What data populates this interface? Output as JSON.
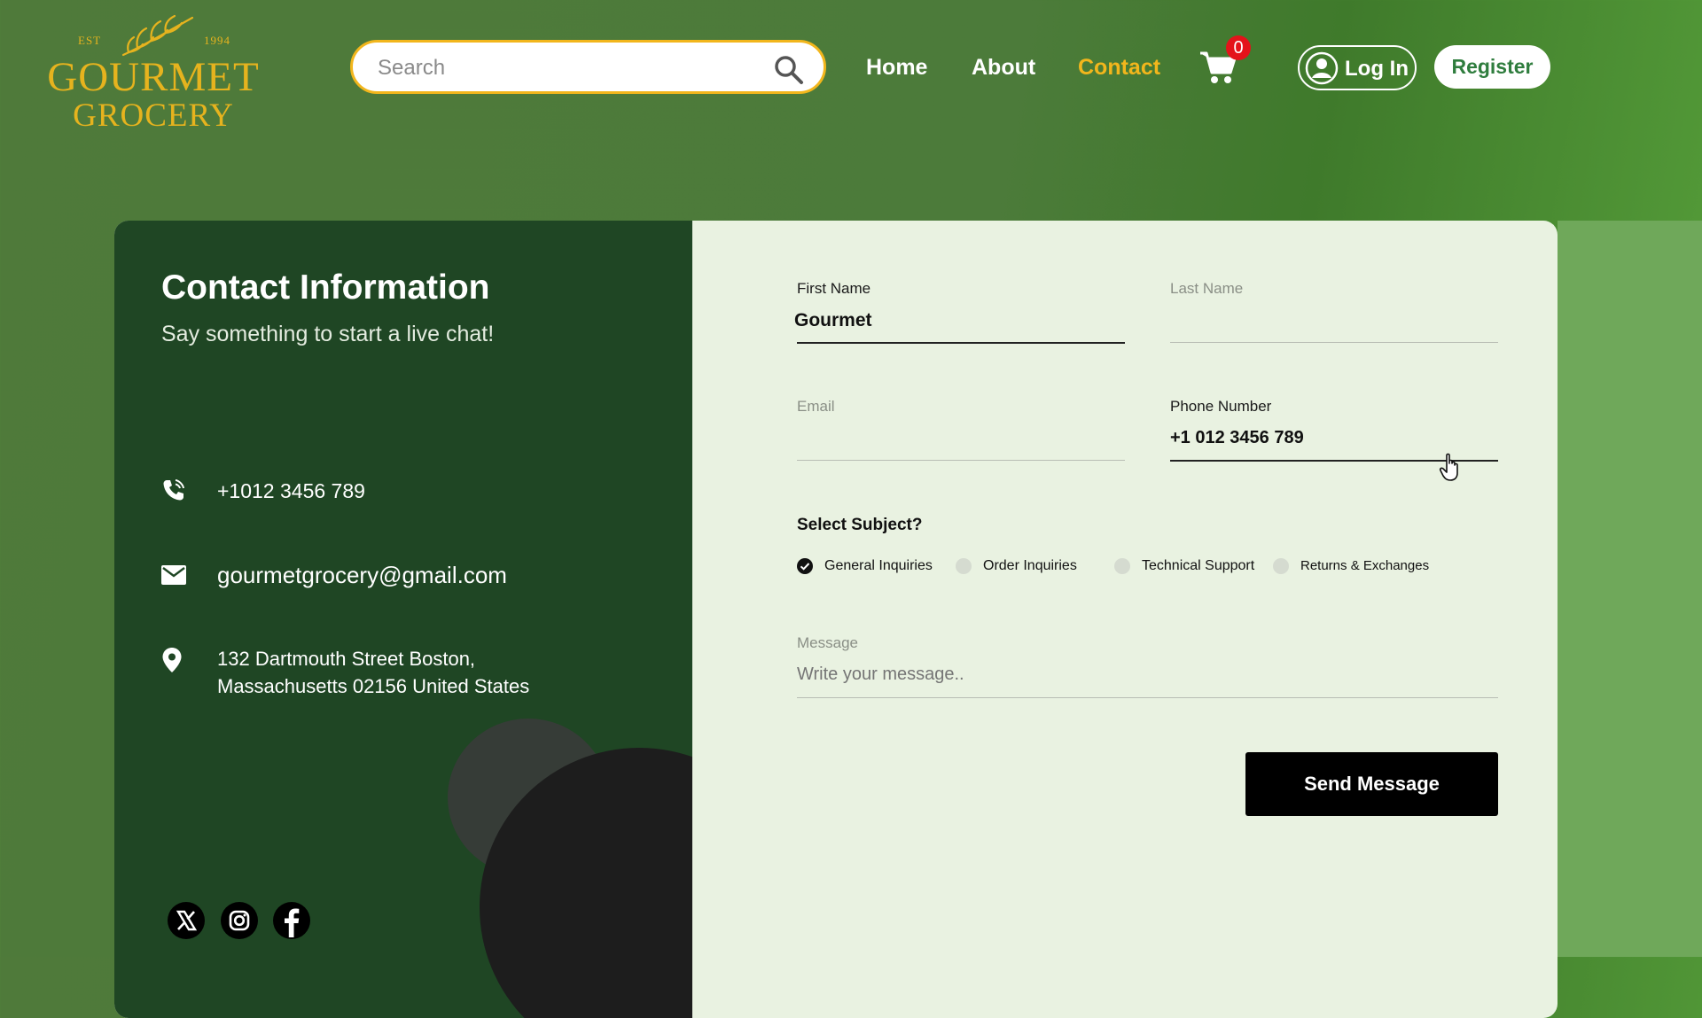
{
  "brand": {
    "est": "EST",
    "year": "1994",
    "line1": "GOURMET",
    "line2": "GROCERY",
    "color": "#e6b31e"
  },
  "search": {
    "placeholder": "Search",
    "value": "",
    "icon": "search-icon"
  },
  "nav": {
    "items": [
      {
        "label": "Home",
        "active": false
      },
      {
        "label": "About",
        "active": false
      },
      {
        "label": "Contact",
        "active": true
      }
    ],
    "active_color": "#f2b61c"
  },
  "cart": {
    "icon": "cart-icon",
    "count": "0",
    "badge_color": "#e4131a"
  },
  "auth": {
    "login_label": "Log In",
    "login_icon": "user-circle-icon",
    "register_label": "Register"
  },
  "contact_info": {
    "title": "Contact Information",
    "subtitle": "Say something to start a live chat!",
    "phone": "+1012 3456 789",
    "email": "gourmetgrocery@gmail.com",
    "address_line1": "132 Dartmouth Street Boston,",
    "address_line2": "Massachusetts 02156 United States",
    "socials": [
      "x-icon",
      "instagram-icon",
      "facebook-icon"
    ],
    "panel_color": "#1f4624"
  },
  "form": {
    "first_name": {
      "label": "First Name",
      "value": "Gourmet"
    },
    "last_name": {
      "label": "Last Name",
      "value": ""
    },
    "email": {
      "label": "Email",
      "value": ""
    },
    "phone": {
      "label": "Phone Number",
      "value": "+1 012 3456 789"
    },
    "subject": {
      "title": "Select Subject?",
      "options": [
        "General Inquiries",
        "Order Inquiries",
        "Technical Support",
        "Returns & Exchanges"
      ],
      "selected": "General Inquiries"
    },
    "message": {
      "label": "Message",
      "placeholder": "Write your message..",
      "value": ""
    },
    "submit_label": "Send Message"
  }
}
